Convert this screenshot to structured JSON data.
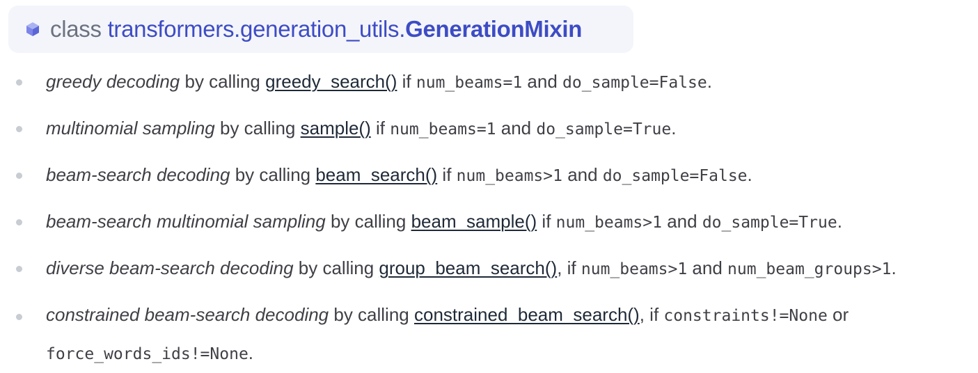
{
  "header": {
    "keyword": "class",
    "module_path": "transformers.generation_utils.",
    "class_name": "GenerationMixin",
    "icon": "cube-icon",
    "accent_color": "#3d4cc4",
    "icon_color": "#6b76e0"
  },
  "items": [
    {
      "term": "greedy decoding",
      "by_calling": " by calling ",
      "link": "greedy_search()",
      "after_link": " if ",
      "code1": "num_beams=1",
      "joiner": " and ",
      "code2": "do_sample=False",
      "end": "."
    },
    {
      "term": "multinomial sampling",
      "by_calling": " by calling ",
      "link": "sample()",
      "after_link": " if ",
      "code1": "num_beams=1",
      "joiner": " and ",
      "code2": "do_sample=True",
      "end": "."
    },
    {
      "term": "beam-search decoding",
      "by_calling": " by calling ",
      "link": "beam_search()",
      "after_link": " if ",
      "code1": "num_beams>1",
      "joiner": " and ",
      "code2": "do_sample=False",
      "end": "."
    },
    {
      "term": "beam-search multinomial sampling",
      "by_calling": " by calling ",
      "link": "beam_sample()",
      "after_link": " if ",
      "code1": "num_beams>1",
      "joiner": " and ",
      "code2": "do_sample=True",
      "end": "."
    },
    {
      "term": "diverse beam-search decoding",
      "by_calling": " by calling ",
      "link": "group_beam_search()",
      "after_link": ", if ",
      "code1": "num_beams>1",
      "joiner": " and ",
      "code2": "num_beam_groups>1",
      "end": "."
    },
    {
      "term": "constrained beam-search decoding",
      "by_calling": " by calling ",
      "link": "constrained_beam_search()",
      "after_link": ", if ",
      "code1": "constraints!=None",
      "joiner": " or ",
      "code2": "force_words_ids!=None",
      "end": "."
    }
  ]
}
